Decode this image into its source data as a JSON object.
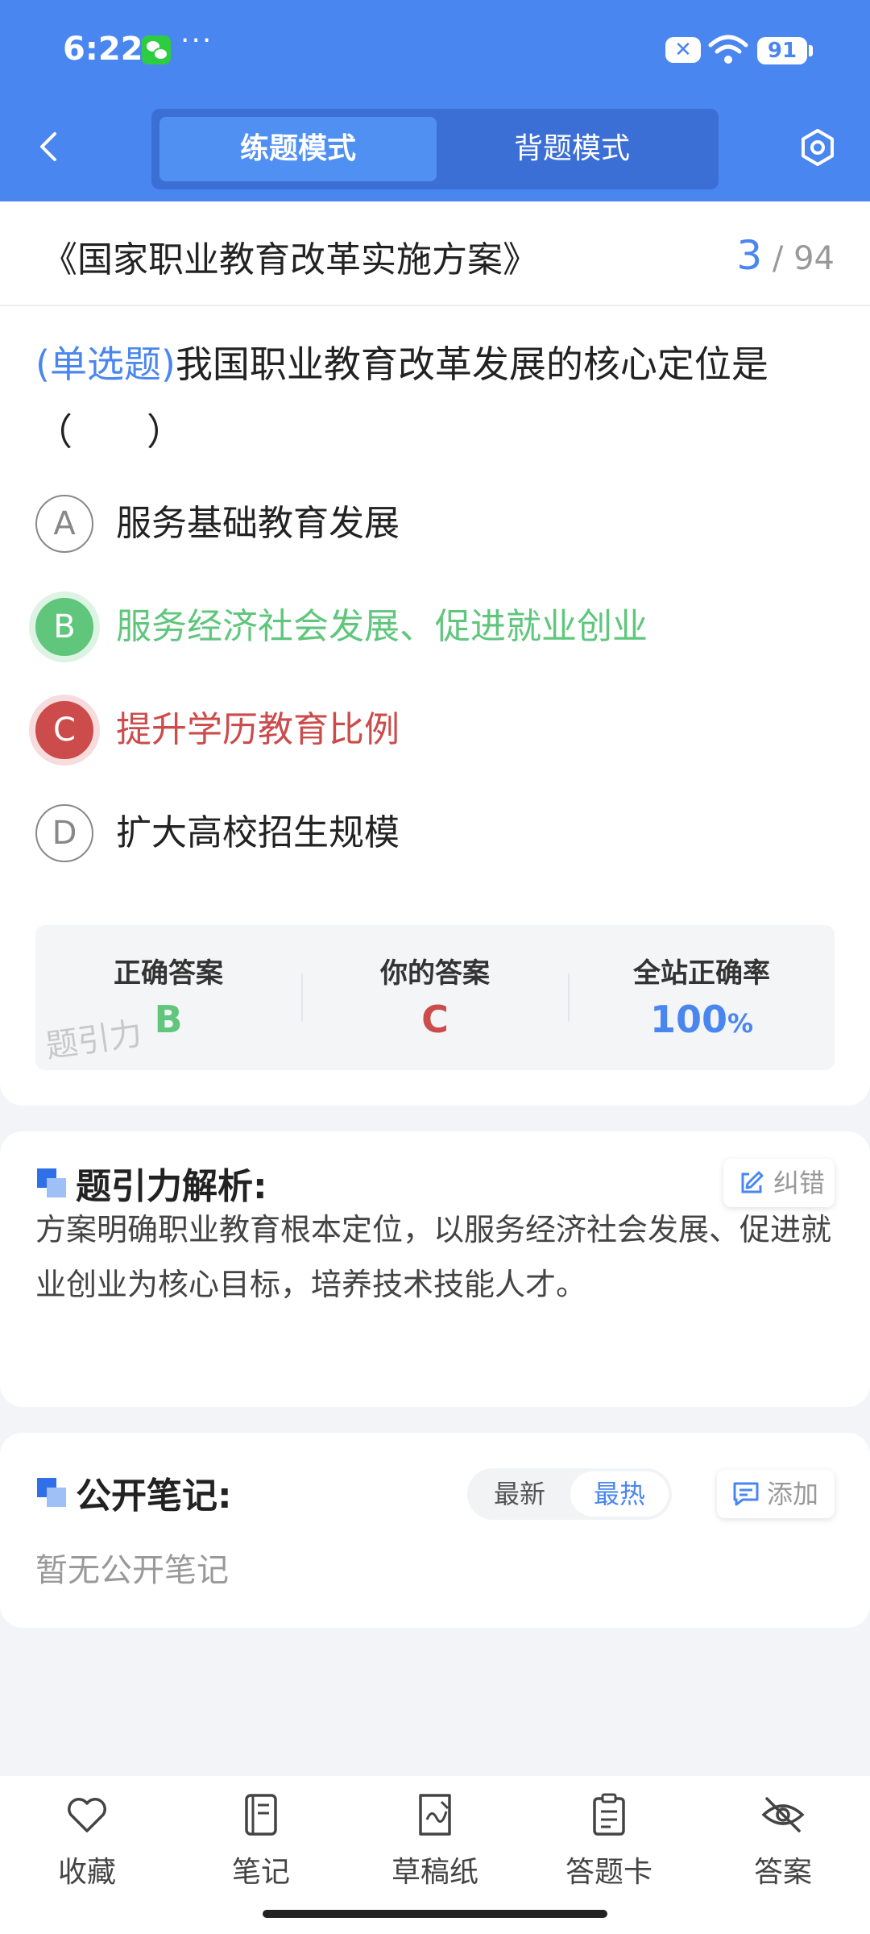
{
  "status_bar": {
    "time": "6:22",
    "dots": "···",
    "battery": "91"
  },
  "header": {
    "mode_tabs": [
      {
        "label": "练题模式",
        "active": true
      },
      {
        "label": "背题模式",
        "active": false
      }
    ]
  },
  "titlebar": {
    "doc_title": "《国家职业教育改革实施方案》",
    "current": "3",
    "total": "/ 94"
  },
  "question": {
    "type": "(单选题)",
    "text": "我国职业教育改革发展的核心定位是（　　）",
    "options": [
      {
        "letter": "A",
        "text": "服务基础教育发展",
        "state": "normal"
      },
      {
        "letter": "B",
        "text": "服务经济社会发展、促进就业创业",
        "state": "correct"
      },
      {
        "letter": "C",
        "text": "提升学历教育比例",
        "state": "wrong"
      },
      {
        "letter": "D",
        "text": "扩大高校招生规模",
        "state": "normal"
      }
    ]
  },
  "answer_summary": {
    "correct_label": "正确答案",
    "correct_value": "B",
    "yours_label": "你的答案",
    "yours_value": "C",
    "rate_label": "全站正确率",
    "rate_value": "100",
    "rate_unit": "%",
    "watermark": "题引力",
    "colors": {
      "correct": "#5fc67c",
      "wrong": "#cc4b4b",
      "rate": "#4a86f0"
    }
  },
  "analysis": {
    "title": "题引力解析:",
    "report_button": "纠错",
    "text": "方案明确职业教育根本定位，以服务经济社会发展、促进就业创业为核心目标，培养技术技能人才。"
  },
  "notes": {
    "title": "公开笔记:",
    "sort_latest": "最新",
    "sort_hot": "最热",
    "add_button": "添加",
    "empty_text": "暂无公开笔记"
  },
  "bottom_bar": [
    {
      "label": "收藏",
      "icon": "heart-icon"
    },
    {
      "label": "笔记",
      "icon": "notebook-icon"
    },
    {
      "label": "草稿纸",
      "icon": "draft-paper-icon"
    },
    {
      "label": "答题卡",
      "icon": "answer-card-icon"
    },
    {
      "label": "答案",
      "icon": "eye-off-icon"
    }
  ],
  "accent_color": "#4a86f0"
}
